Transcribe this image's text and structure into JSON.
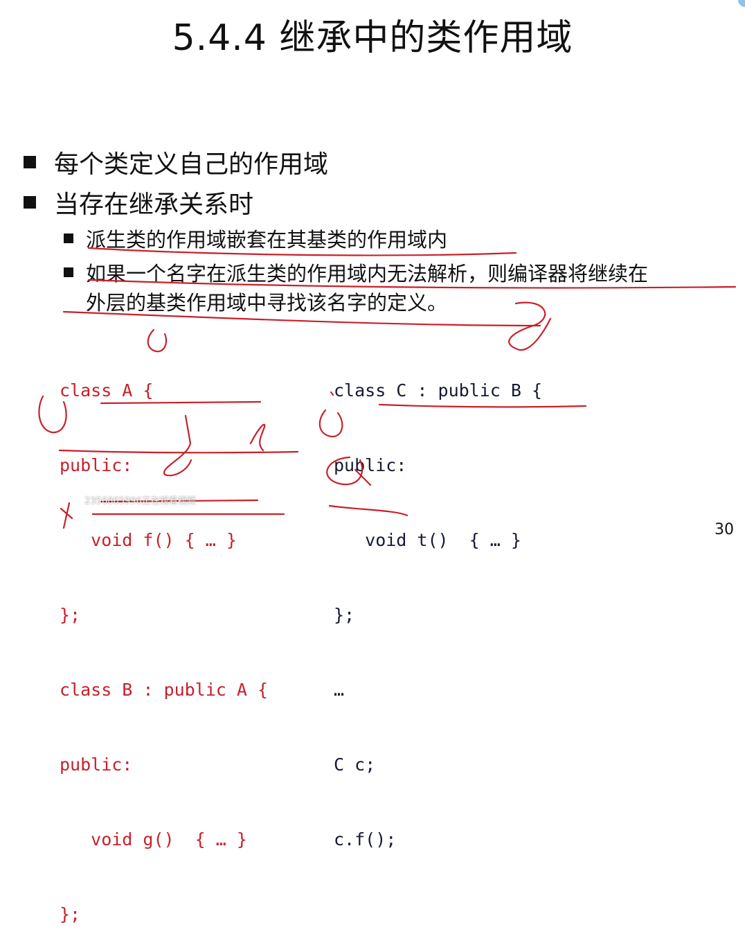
{
  "slide": {
    "title": "5.4.4 继承中的类作用域",
    "page_number": "30"
  },
  "bullets": {
    "level1": [
      "每个类定义自己的作用域",
      "当存在继承关系时"
    ],
    "level2": [
      "派生类的作用域嵌套在其基类的作用域内",
      "如果一个名字在派生类的作用域内无法解析，则编译器将继续在"
    ],
    "level2_continuation": "外层的基类作用域中寻找该名字的定义。"
  },
  "code_left": {
    "lines": [
      "class A {",
      "public:",
      "   void f() { … }",
      "};",
      "class B : public A {",
      "public:",
      "   void g()  { … }",
      "};"
    ]
  },
  "code_right": {
    "lines": [
      "class C : public B {",
      "public:",
      "   void t()  { … }",
      "};",
      "…",
      "C c;",
      "c.f();"
    ]
  },
  "watermark": "2356865996正在观看视频",
  "colors": {
    "annotation_ink": "#c8202a",
    "left_code": "#c8202a",
    "right_code": "#151a33"
  }
}
